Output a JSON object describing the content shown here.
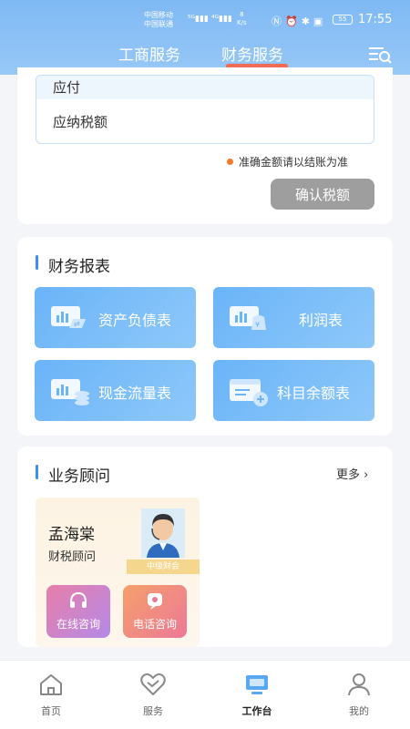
{
  "status_bar": {
    "carrier1": "中国移动",
    "carrier2": "中国联通",
    "net_speed": "8",
    "net_unit": "K/s",
    "battery": "55",
    "time": "17:55"
  },
  "header": {
    "tabs": [
      {
        "label": "工商服务",
        "active": false
      },
      {
        "label": "财务服务",
        "active": true
      }
    ],
    "menu_icon": "list-search-icon"
  },
  "tax_card": {
    "row_partial": "应付",
    "row_label": "应纳税额",
    "note": "准确金额请以结账为准",
    "confirm_label": "确认税额"
  },
  "reports": {
    "title": "财务报表",
    "items": [
      {
        "label": "资产负债表",
        "icon": "balance-sheet-icon"
      },
      {
        "label": "利润表",
        "icon": "profit-icon"
      },
      {
        "label": "现金流量表",
        "icon": "cash-flow-icon"
      },
      {
        "label": "科目余额表",
        "icon": "account-balance-icon"
      }
    ]
  },
  "advisor": {
    "title": "业务顾问",
    "more": "更多",
    "name": "孟海棠",
    "role": "财税顾问",
    "badge": "中级财会",
    "online_label": "在线咨询",
    "phone_label": "电话咨询"
  },
  "bottom_nav": {
    "items": [
      {
        "label": "首页",
        "icon": "home-icon"
      },
      {
        "label": "服务",
        "icon": "service-icon"
      },
      {
        "label": "工作台",
        "icon": "workbench-icon",
        "active": true
      },
      {
        "label": "我的",
        "icon": "profile-icon"
      }
    ]
  },
  "colors": {
    "header_gradient": "#7fb9f4",
    "accent_underline": "#ef6b55",
    "report_button": "#6ab4f8",
    "section_bar": "#3a8ff0"
  }
}
